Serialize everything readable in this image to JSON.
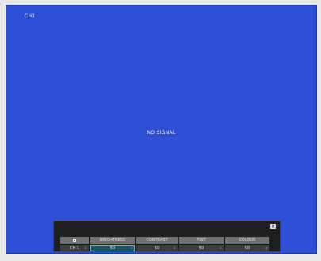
{
  "screen": {
    "channel_label": "CH1",
    "status_text": "NO SIGNAL",
    "background_color": "#2c4fd6"
  },
  "adjust_panel": {
    "close_label": "×",
    "header_icon": "square-icon",
    "columns": [
      "BRIGHTNESS",
      "CONTRAST",
      "TINT",
      "COLOUR"
    ],
    "channel_select": "CH 1",
    "values": {
      "brightness": "50",
      "contrast": "50",
      "tint": "50",
      "colour": "50"
    },
    "spinner_glyph": "⇕",
    "selected_color": "#59c0dc"
  }
}
